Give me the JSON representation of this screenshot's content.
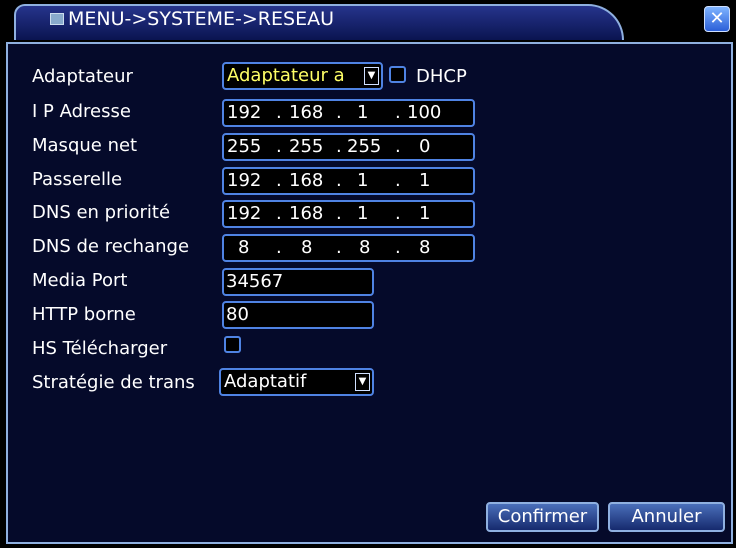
{
  "window": {
    "title": "MENU->SYSTEME->RESEAU",
    "close_icon": "close-icon"
  },
  "form": {
    "adaptateur": {
      "label": "Adaptateur",
      "value": "Adaptateur a"
    },
    "dhcp": {
      "label": "DHCP",
      "checked": false
    },
    "ip_adresse": {
      "label": "I P Adresse",
      "octets": [
        "192",
        "168",
        "1",
        "100"
      ]
    },
    "masque_net": {
      "label": "Masque net",
      "octets": [
        "255",
        "255",
        "255",
        "0"
      ]
    },
    "passerelle": {
      "label": "Passerelle",
      "octets": [
        "192",
        "168",
        "1",
        "1"
      ]
    },
    "dns_priorite": {
      "label": "DNS en priorité",
      "octets": [
        "192",
        "168",
        "1",
        "1"
      ]
    },
    "dns_rechange": {
      "label": "DNS de rechange",
      "octets": [
        "8",
        "8",
        "8",
        "8"
      ]
    },
    "media_port": {
      "label": "Media Port",
      "value": "34567"
    },
    "http_borne": {
      "label": "HTTP borne",
      "value": "80"
    },
    "hs_telecharger": {
      "label": "HS Télécharger",
      "checked": false
    },
    "strategie": {
      "label": "Stratégie de trans",
      "value": "Adaptatif"
    },
    "dot": "."
  },
  "buttons": {
    "confirm": "Confirmer",
    "cancel": "Annuler"
  },
  "colors": {
    "accent_yellow": "#ffff66",
    "border_blue": "#4f83e3"
  }
}
